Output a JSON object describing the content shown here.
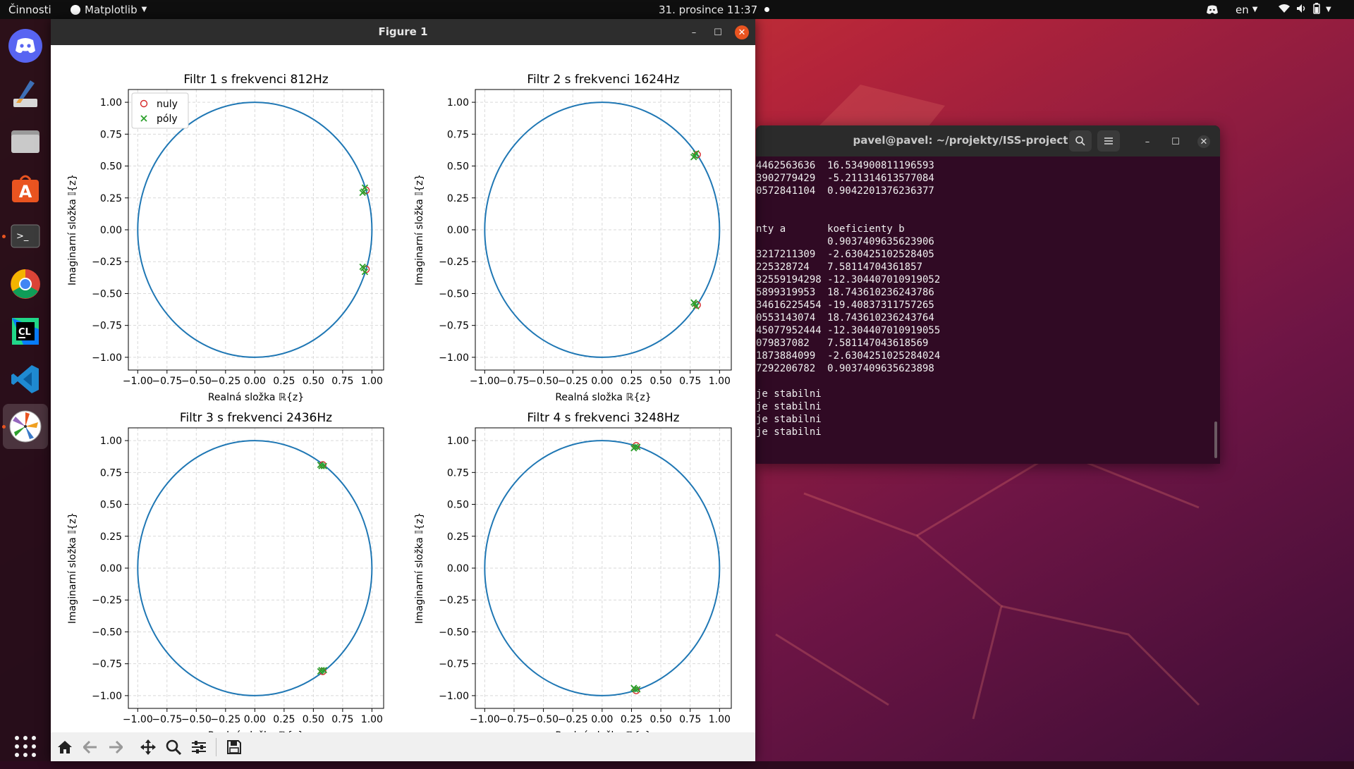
{
  "topbar": {
    "activities": "Činnosti",
    "app_menu": "Matplotlib",
    "clock": "31. prosince  11:37",
    "language": "en"
  },
  "dock": {
    "items": [
      {
        "name": "discord"
      },
      {
        "name": "drawing-app"
      },
      {
        "name": "files"
      },
      {
        "name": "software-center"
      },
      {
        "name": "terminal"
      },
      {
        "name": "chrome"
      },
      {
        "name": "clion"
      },
      {
        "name": "vscode"
      },
      {
        "name": "matplotlib"
      },
      {
        "name": "show-applications"
      }
    ]
  },
  "terminal": {
    "title": "pavel@pavel: ~/projekty/ISS-project",
    "lines": [
      "4462563636  16.534900811196593",
      "3902779429  -5.211314613577084",
      "0572841104  0.9042201376236377",
      "",
      "",
      "nty a       koeficienty b",
      "            0.9037409635623906",
      "3217211309  -2.630425102528405",
      "225328724   7.58114704361857",
      "32559194298 -12.304407010919052",
      "5899319953  18.743610236243786",
      "34616225454 -19.40837311757265",
      "0553143074  18.743610236243764",
      "45077952444 -12.304407010919055",
      "079837082   7.581147043618569",
      "1873884099  -2.6304251025284024",
      "7292206782  0.9037409635623898",
      "",
      "je stabilni",
      "je stabilni",
      "je stabilni",
      "je stabilni"
    ]
  },
  "figure": {
    "window_title": "Figure 1"
  },
  "colors": {
    "circle": "#1f77b4",
    "zeros": "#d62728",
    "poles": "#2ca02c",
    "terminal_bg": "#300a24",
    "topbar_bg": "#0f0f0f"
  },
  "chart_data": [
    {
      "type": "scatter",
      "title": "Filtr 1 s frekvenci 812Hz",
      "xlabel": "Realná složka ℝ{z}",
      "ylabel": "Imaginarní složka 𝕀{z}",
      "xlim": [
        -1.08,
        1.1
      ],
      "ylim": [
        -1.1,
        1.1
      ],
      "xticks": [
        "−1.00",
        "−0.75",
        "−0.50",
        "−0.25",
        "0.00",
        "0.25",
        "0.50",
        "0.75",
        "1.00"
      ],
      "yticks": [
        "1.00",
        "0.75",
        "0.50",
        "0.25",
        "0.00",
        "−0.25",
        "−0.50",
        "−0.75",
        "−1.00"
      ],
      "grid": true,
      "unit_circle": true,
      "legend": [
        "nuly",
        "póly"
      ],
      "legend_position": "upper-left",
      "series": [
        {
          "name": "nuly",
          "marker": "o",
          "points": [
            [
              0.95,
              0.31
            ],
            [
              0.95,
              -0.31
            ]
          ]
        },
        {
          "name": "póly",
          "marker": "x",
          "points": [
            [
              0.93,
              0.3
            ],
            [
              0.94,
              0.33
            ],
            [
              0.92,
              0.29
            ],
            [
              0.93,
              -0.3
            ],
            [
              0.94,
              -0.33
            ],
            [
              0.92,
              -0.29
            ]
          ]
        }
      ]
    },
    {
      "type": "scatter",
      "title": "Filtr 2 s frekvenci 1624Hz",
      "xlabel": "Realná složka ℝ{z}",
      "ylabel": "Imaginarní složka 𝕀{z}",
      "xlim": [
        -1.08,
        1.1
      ],
      "ylim": [
        -1.1,
        1.1
      ],
      "xticks": [
        "−1.00",
        "−0.75",
        "−0.50",
        "−0.25",
        "0.00",
        "0.25",
        "0.50",
        "0.75",
        "1.00"
      ],
      "yticks": [
        "1.00",
        "0.75",
        "0.50",
        "0.25",
        "0.00",
        "−0.25",
        "−0.50",
        "−0.75",
        "−1.00"
      ],
      "grid": true,
      "unit_circle": true,
      "series": [
        {
          "name": "nuly",
          "marker": "o",
          "points": [
            [
              0.81,
              0.59
            ],
            [
              0.81,
              -0.59
            ]
          ]
        },
        {
          "name": "póly",
          "marker": "x",
          "points": [
            [
              0.79,
              0.58
            ],
            [
              0.8,
              0.6
            ],
            [
              0.78,
              0.57
            ],
            [
              0.79,
              -0.58
            ],
            [
              0.8,
              -0.6
            ],
            [
              0.78,
              -0.57
            ]
          ]
        }
      ]
    },
    {
      "type": "scatter",
      "title": "Filtr 3 s frekvenci 2436Hz",
      "xlabel": "Realná složka ℝ{z}",
      "ylabel": "Imaginarní složka 𝕀{z}",
      "xlim": [
        -1.08,
        1.1
      ],
      "ylim": [
        -1.1,
        1.1
      ],
      "xticks": [
        "−1.00",
        "−0.75",
        "−0.50",
        "−0.25",
        "0.00",
        "0.25",
        "0.50",
        "0.75",
        "1.00"
      ],
      "yticks": [
        "1.00",
        "0.75",
        "0.50",
        "0.25",
        "0.00",
        "−0.25",
        "−0.50",
        "−0.75",
        "−1.00"
      ],
      "grid": true,
      "unit_circle": true,
      "series": [
        {
          "name": "nuly",
          "marker": "o",
          "points": [
            [
              0.58,
              0.81
            ],
            [
              0.58,
              -0.81
            ]
          ]
        },
        {
          "name": "póly",
          "marker": "x",
          "points": [
            [
              0.57,
              0.8
            ],
            [
              0.59,
              0.8
            ],
            [
              0.56,
              0.81
            ],
            [
              0.57,
              -0.8
            ],
            [
              0.59,
              -0.8
            ],
            [
              0.56,
              -0.81
            ]
          ]
        }
      ]
    },
    {
      "type": "scatter",
      "title": "Filtr 4 s frekvenci 3248Hz",
      "xlabel": "Realná složka ℝ{z}",
      "ylabel": "Imaginarní složka 𝕀{z}",
      "xlim": [
        -1.08,
        1.1
      ],
      "ylim": [
        -1.1,
        1.1
      ],
      "xticks": [
        "−1.00",
        "−0.75",
        "−0.50",
        "−0.25",
        "0.00",
        "0.25",
        "0.50",
        "0.75",
        "1.00"
      ],
      "yticks": [
        "1.00",
        "0.75",
        "0.50",
        "0.25",
        "0.00",
        "−0.25",
        "−0.50",
        "−0.75",
        "−1.00"
      ],
      "grid": true,
      "unit_circle": true,
      "series": [
        {
          "name": "nuly",
          "marker": "o",
          "points": [
            [
              0.29,
              0.96
            ],
            [
              0.29,
              -0.96
            ]
          ]
        },
        {
          "name": "póly",
          "marker": "x",
          "points": [
            [
              0.28,
              0.95
            ],
            [
              0.3,
              0.95
            ],
            [
              0.27,
              0.94
            ],
            [
              0.28,
              -0.95
            ],
            [
              0.3,
              -0.95
            ],
            [
              0.27,
              -0.94
            ]
          ]
        }
      ]
    }
  ]
}
